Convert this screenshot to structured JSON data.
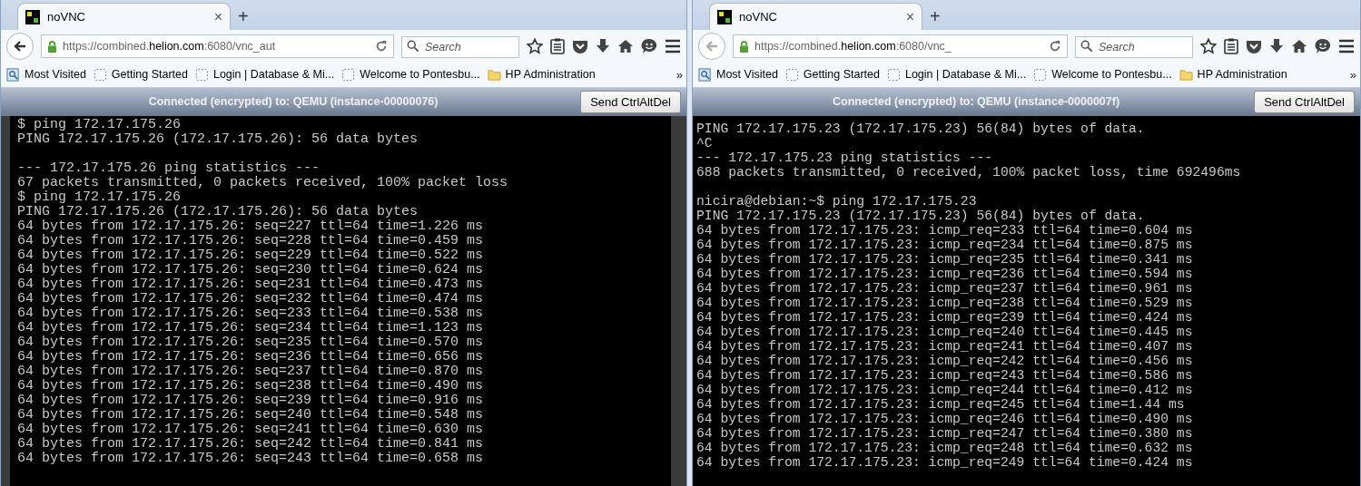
{
  "windows": [
    {
      "tab_title": "noVNC",
      "close_glyph": "×",
      "new_tab_glyph": "+",
      "url": "https://combined.**helion.com**:6080/vnc_aut",
      "search": {
        "placeholder": "Search"
      },
      "back_enabled": true,
      "bookmarks": [
        {
          "kind": "most-visited",
          "label": "Most Visited"
        },
        {
          "kind": "page",
          "label": "Getting Started"
        },
        {
          "kind": "page",
          "label": "Login | Database & Mi..."
        },
        {
          "kind": "page",
          "label": "Welcome to Pontesbu..."
        },
        {
          "kind": "folder",
          "label": "HP Administration"
        }
      ],
      "overflow": "»",
      "status": "Connected (encrypted) to: QEMU (instance-00000076)",
      "button": "Send CtrlAltDel",
      "terminal_blocks": [
        [
          "$ ping 172.17.175.26",
          "PING 172.17.175.26 (172.17.175.26): 56 data bytes"
        ],
        [
          "--- 172.17.175.26 ping statistics ---",
          "67 packets transmitted, 0 packets received, 100% packet loss",
          "$ ping 172.17.175.26",
          "PING 172.17.175.26 (172.17.175.26): 56 data bytes",
          "64 bytes from 172.17.175.26: seq=227 ttl=64 time=1.226 ms",
          "64 bytes from 172.17.175.26: seq=228 ttl=64 time=0.459 ms",
          "64 bytes from 172.17.175.26: seq=229 ttl=64 time=0.522 ms",
          "64 bytes from 172.17.175.26: seq=230 ttl=64 time=0.624 ms",
          "64 bytes from 172.17.175.26: seq=231 ttl=64 time=0.473 ms",
          "64 bytes from 172.17.175.26: seq=232 ttl=64 time=0.474 ms",
          "64 bytes from 172.17.175.26: seq=233 ttl=64 time=0.538 ms",
          "64 bytes from 172.17.175.26: seq=234 ttl=64 time=1.123 ms",
          "64 bytes from 172.17.175.26: seq=235 ttl=64 time=0.570 ms",
          "64 bytes from 172.17.175.26: seq=236 ttl=64 time=0.656 ms",
          "64 bytes from 172.17.175.26: seq=237 ttl=64 time=0.870 ms",
          "64 bytes from 172.17.175.26: seq=238 ttl=64 time=0.490 ms",
          "64 bytes from 172.17.175.26: seq=239 ttl=64 time=0.916 ms",
          "64 bytes from 172.17.175.26: seq=240 ttl=64 time=0.548 ms",
          "64 bytes from 172.17.175.26: seq=241 ttl=64 time=0.630 ms",
          "64 bytes from 172.17.175.26: seq=242 ttl=64 time=0.841 ms",
          "64 bytes from 172.17.175.26: seq=243 ttl=64 time=0.658 ms"
        ]
      ]
    },
    {
      "tab_title": "noVNC",
      "close_glyph": "×",
      "new_tab_glyph": "+",
      "url": "https://combined.**helion.com**:6080/vnc_",
      "search": {
        "placeholder": "Search"
      },
      "back_enabled": false,
      "bookmarks": [
        {
          "kind": "most-visited",
          "label": "Most Visited"
        },
        {
          "kind": "page",
          "label": "Getting Started"
        },
        {
          "kind": "page",
          "label": "Login | Database & Mi..."
        },
        {
          "kind": "page",
          "label": "Welcome to Pontesbu..."
        },
        {
          "kind": "folder",
          "label": "HP Administration"
        }
      ],
      "overflow": "»",
      "status": "Connected (encrypted) to: QEMU (instance-0000007f)",
      "button": "Send CtrlAltDel",
      "terminal_blocks": [
        [
          "PING 172.17.175.23 (172.17.175.23) 56(84) bytes of data.",
          "^C",
          "--- 172.17.175.23 ping statistics ---",
          "688 packets transmitted, 0 received, 100% packet loss, time 692496ms"
        ],
        [
          "nicira@debian:~$ ping 172.17.175.23",
          "PING 172.17.175.23 (172.17.175.23) 56(84) bytes of data.",
          "64 bytes from 172.17.175.23: icmp_req=233 ttl=64 time=0.604 ms",
          "64 bytes from 172.17.175.23: icmp_req=234 ttl=64 time=0.875 ms",
          "64 bytes from 172.17.175.23: icmp_req=235 ttl=64 time=0.341 ms",
          "64 bytes from 172.17.175.23: icmp_req=236 ttl=64 time=0.594 ms",
          "64 bytes from 172.17.175.23: icmp_req=237 ttl=64 time=0.961 ms",
          "64 bytes from 172.17.175.23: icmp_req=238 ttl=64 time=0.529 ms",
          "64 bytes from 172.17.175.23: icmp_req=239 ttl=64 time=0.424 ms",
          "64 bytes from 172.17.175.23: icmp_req=240 ttl=64 time=0.445 ms",
          "64 bytes from 172.17.175.23: icmp_req=241 ttl=64 time=0.407 ms",
          "64 bytes from 172.17.175.23: icmp_req=242 ttl=64 time=0.456 ms",
          "64 bytes from 172.17.175.23: icmp_req=243 ttl=64 time=0.586 ms",
          "64 bytes from 172.17.175.23: icmp_req=244 ttl=64 time=0.412 ms",
          "64 bytes from 172.17.175.23: icmp_req=245 ttl=64 time=1.44 ms",
          "64 bytes from 172.17.175.23: icmp_req=246 ttl=64 time=0.490 ms",
          "64 bytes from 172.17.175.23: icmp_req=247 ttl=64 time=0.380 ms",
          "64 bytes from 172.17.175.23: icmp_req=248 ttl=64 time=0.632 ms",
          "64 bytes from 172.17.175.23: icmp_req=249 ttl=64 time=0.424 ms"
        ]
      ]
    }
  ]
}
